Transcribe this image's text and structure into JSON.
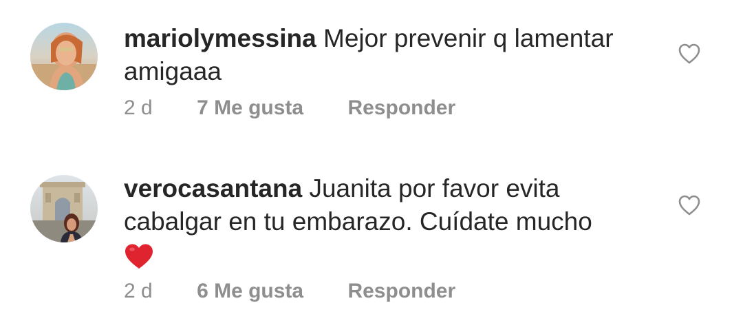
{
  "comments": [
    {
      "username": "mariolymessina",
      "text": "Mejor prevenir q lamentar amigaaa",
      "time": "2 d",
      "likes": "7 Me gusta",
      "reply": "Responder",
      "like_icon": "heart-outline-icon"
    },
    {
      "username": "verocasantana",
      "text": "Juanita por favor evita cabalgar en tu embarazo. Cuídate mucho",
      "emoji": "red-heart-emoji",
      "time": "2 d",
      "likes": "6 Me gusta",
      "reply": "Responder",
      "like_icon": "heart-outline-icon"
    }
  ],
  "colors": {
    "text": "#262626",
    "meta": "#8e8e8e",
    "heart_emoji": "#e0242f"
  }
}
